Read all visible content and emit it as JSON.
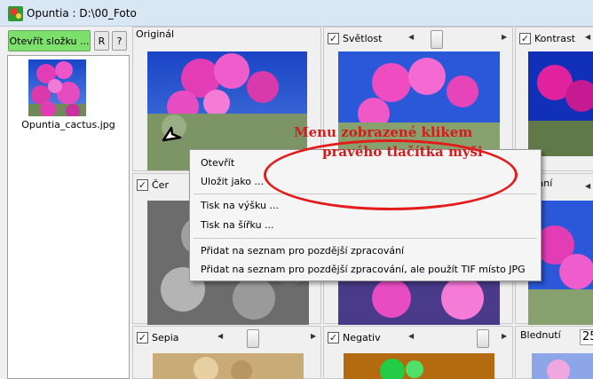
{
  "window": {
    "title": "Opuntia : D:\\00_Foto"
  },
  "toolbar": {
    "open_folder_label": "Otevřít složku ...",
    "r_label": "R",
    "help_label": "?"
  },
  "files": [
    {
      "name": "Opuntia_cactus.jpg"
    }
  ],
  "panels": [
    {
      "label": "Originál",
      "checkbox": false,
      "slider": false
    },
    {
      "label": "Světlost",
      "checkbox": true,
      "slider": true,
      "slider_position": 0.5
    },
    {
      "label": "Kontrast",
      "checkbox": true,
      "slider": false
    },
    {
      "label": "Čer",
      "checkbox": true,
      "slider": false
    },
    {
      "label": "azání",
      "checkbox": false,
      "slider": false
    },
    {
      "label": "Sepia",
      "checkbox": true,
      "slider": true,
      "slider_position": 0.55
    },
    {
      "label": "Negativ",
      "checkbox": true,
      "slider": true,
      "slider_position": 0.9
    },
    {
      "label": "Blednutí",
      "checkbox": false,
      "value": "25"
    }
  ],
  "context_menu": {
    "items": [
      "Otevřít",
      "Uložit jako ...",
      "Tisk na výšku ...",
      "Tisk na šířku ...",
      "Přidat na seznam pro pozdější zpracování",
      "Přidat na seznam pro pozdější zpracování, ale použít TIF místo JPG"
    ]
  },
  "annotation": {
    "line1": "Menu zobrazené klikem",
    "line2": "pravého tlačítka myši",
    "color": "#d41c1c"
  },
  "colors": {
    "open_button": "#7ee06c",
    "titlebar": "#d9e6f4",
    "sky": "#1c4fd1",
    "flower": "#e23db5"
  }
}
